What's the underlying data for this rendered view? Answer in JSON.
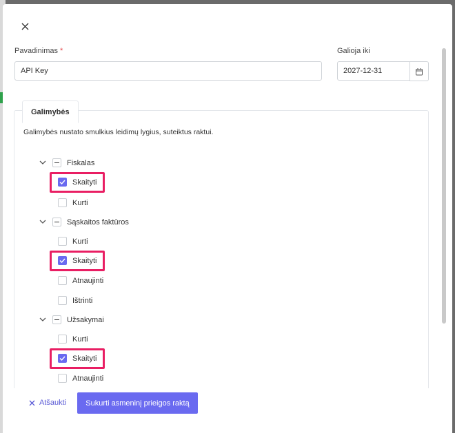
{
  "modal": {
    "name_label": "Pavadinimas",
    "required_mark": "*",
    "name_value": "API Key",
    "valid_until_label": "Galioja iki",
    "valid_until_value": "2027-12-31"
  },
  "permissions": {
    "tab_label": "Galimybės",
    "description": "Galimybės nustato smulkius leidimų lygius, suteiktus raktui.",
    "groups": [
      {
        "label": "Fiskalas",
        "items": [
          {
            "label": "Skaityti",
            "checked": true
          },
          {
            "label": "Kurti",
            "checked": false
          }
        ]
      },
      {
        "label": "Sąskaitos faktūros",
        "items": [
          {
            "label": "Kurti",
            "checked": false
          },
          {
            "label": "Skaityti",
            "checked": true
          },
          {
            "label": "Atnaujinti",
            "checked": false
          },
          {
            "label": "Ištrinti",
            "checked": false
          }
        ]
      },
      {
        "label": "Užsakymai",
        "items": [
          {
            "label": "Kurti",
            "checked": false
          },
          {
            "label": "Skaityti",
            "checked": true
          },
          {
            "label": "Atnaujinti",
            "checked": false
          }
        ]
      }
    ]
  },
  "footer": {
    "cancel_label": "Atšaukti",
    "submit_label": "Sukurti asmeninį prieigos raktą"
  },
  "colors": {
    "accent": "#6a6af0",
    "highlight": "#e91e63"
  }
}
